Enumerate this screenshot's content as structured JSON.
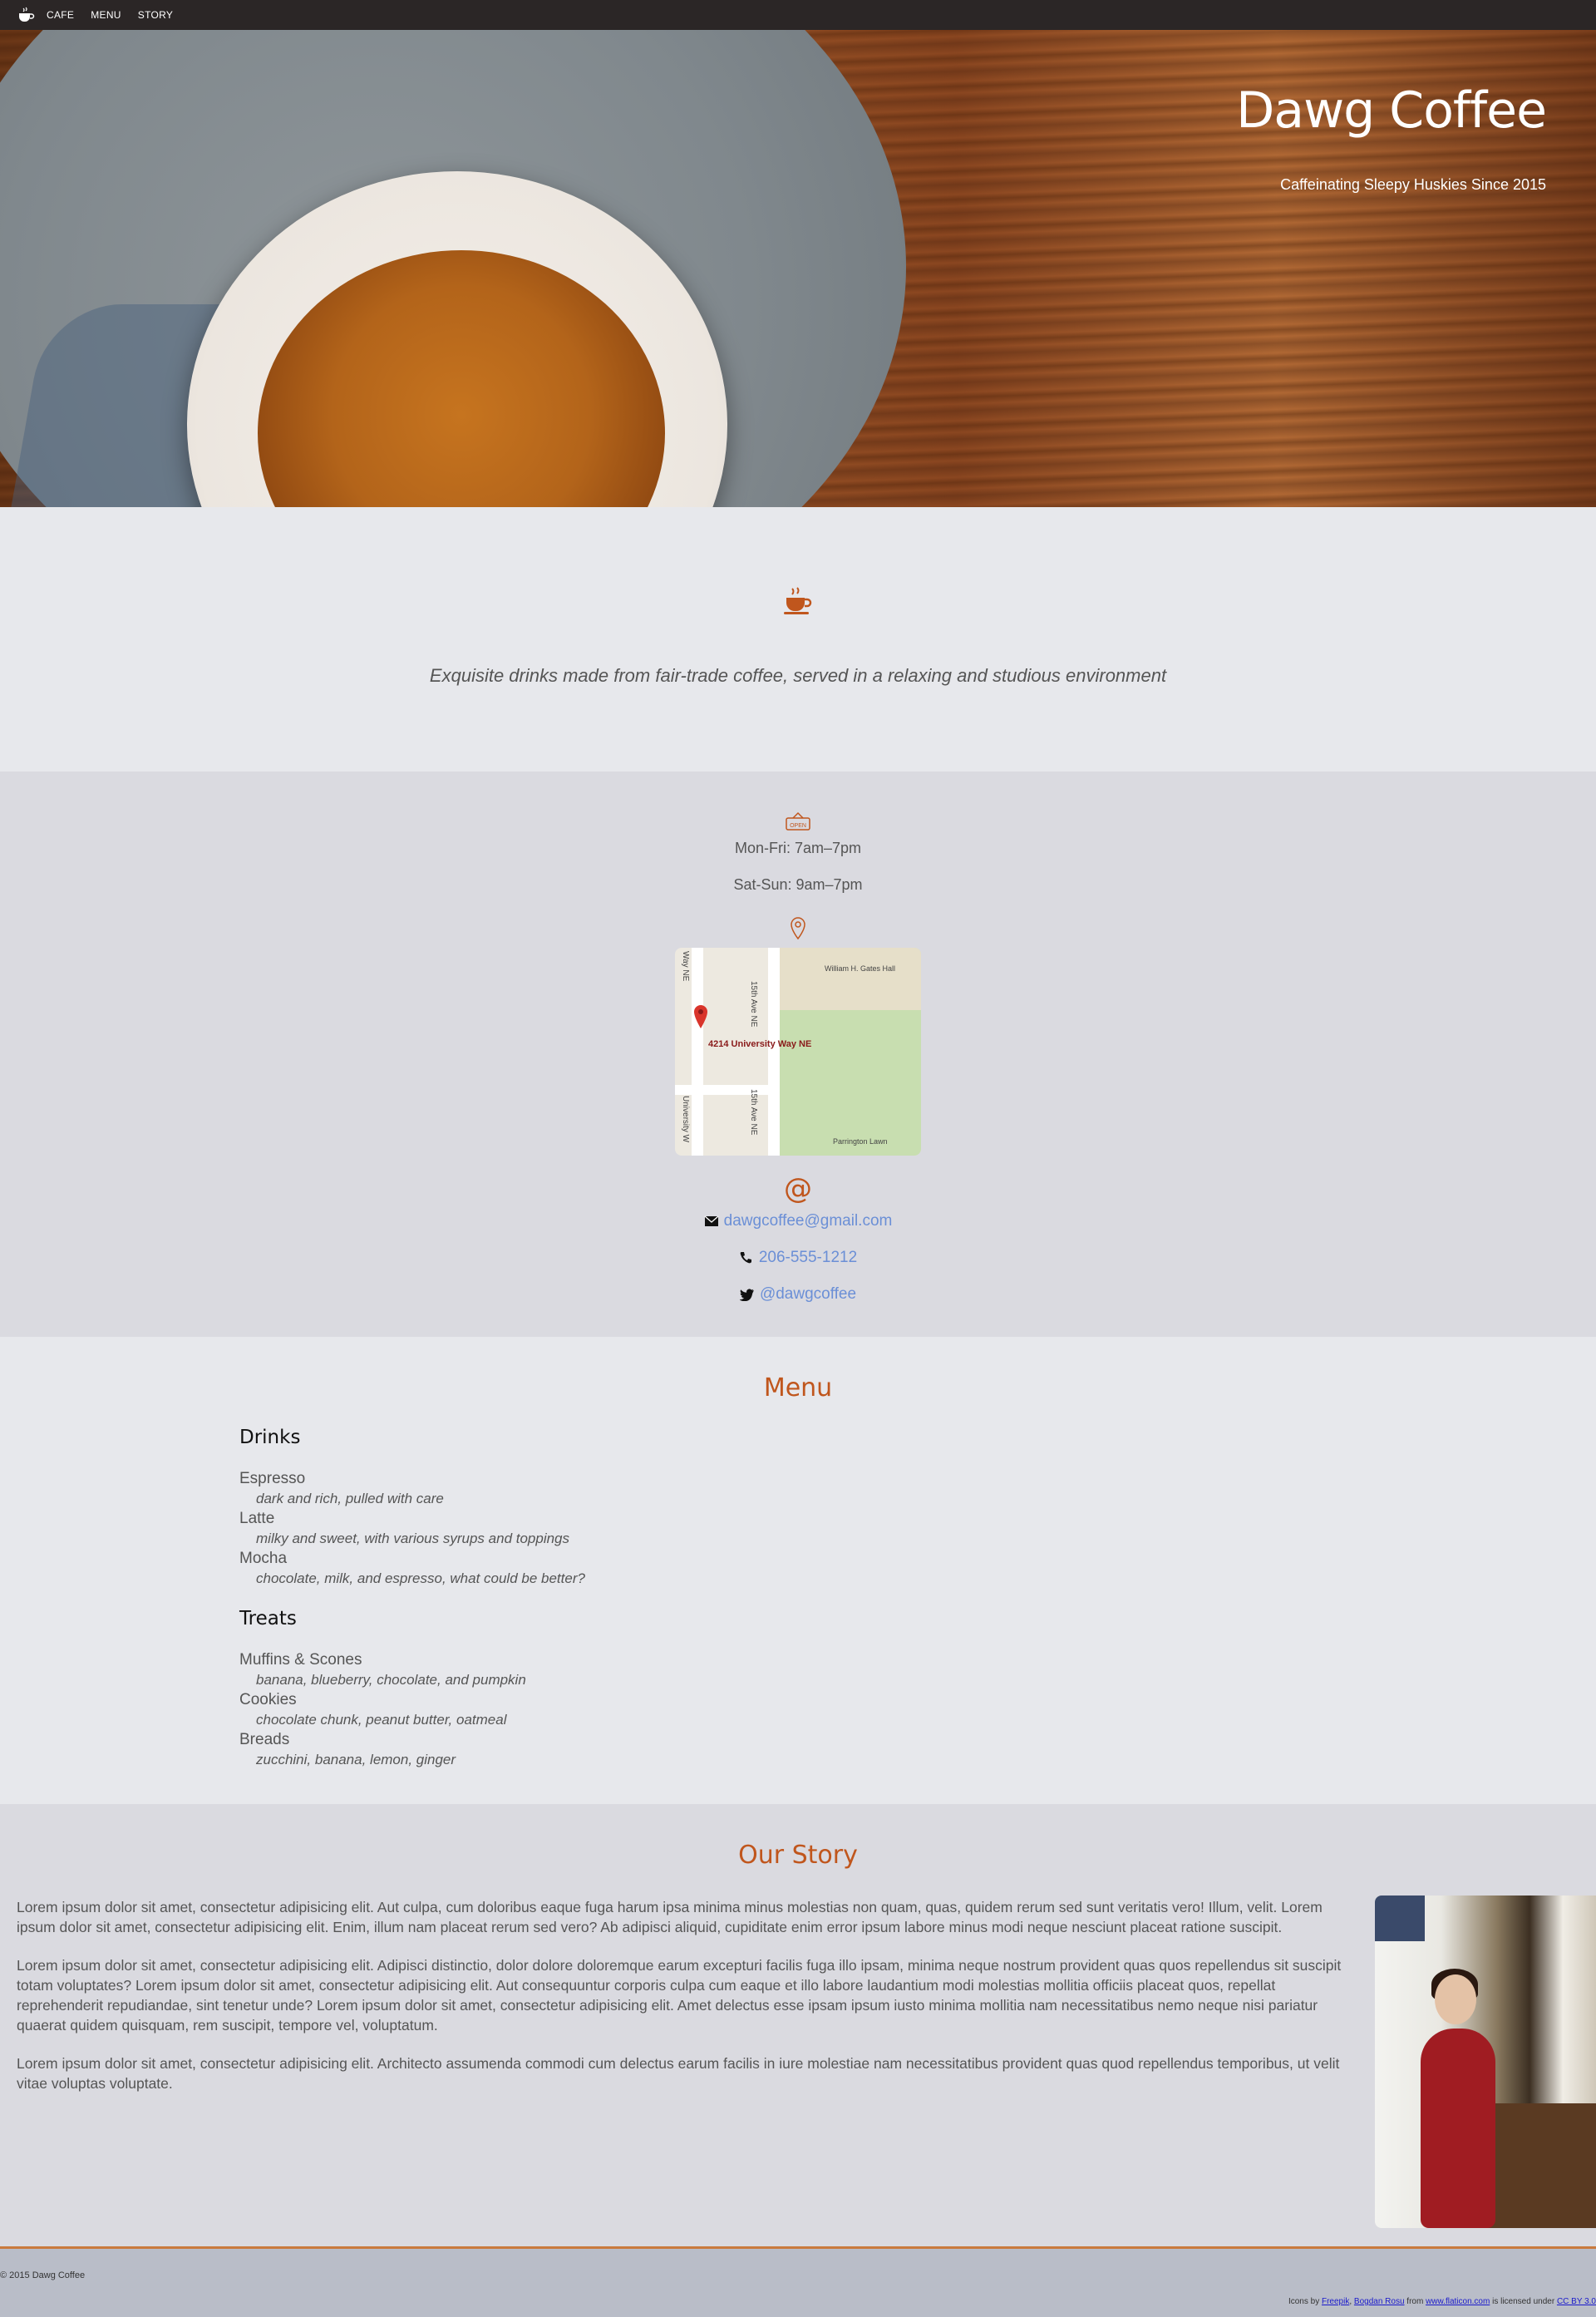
{
  "nav": {
    "items": [
      "CAFE",
      "MENU",
      "STORY"
    ]
  },
  "hero": {
    "title": "Dawg Coffee",
    "tagline": "Caffeinating Sleepy Huskies Since 2015"
  },
  "intro": {
    "text": "Exquisite drinks made from fair-trade coffee, served in a relaxing and studious environment"
  },
  "info": {
    "hours": [
      "Mon-Fri: 7am–7pm",
      "Sat-Sun: 9am–7pm"
    ],
    "map": {
      "address": "4214 University Way NE",
      "streets": [
        "15th Ave NE",
        "15th Ave NE",
        "Way NE",
        "University W"
      ],
      "places": [
        "William H. Gates Hall",
        "Parrington Lawn"
      ]
    },
    "at_symbol": "@",
    "email": "dawgcoffee@gmail.com",
    "phone": "206-555-1212",
    "twitter": "@dawgcoffee",
    "colors": {
      "accent": "#c0561d",
      "link": "#6b8fd6"
    }
  },
  "menu": {
    "title": "Menu",
    "sections": [
      {
        "name": "Drinks",
        "items": [
          {
            "name": "Espresso",
            "desc": "dark and rich, pulled with care"
          },
          {
            "name": "Latte",
            "desc": "milky and sweet, with various syrups and toppings"
          },
          {
            "name": "Mocha",
            "desc": "chocolate, milk, and espresso, what could be better?"
          }
        ]
      },
      {
        "name": "Treats",
        "items": [
          {
            "name": "Muffins & Scones",
            "desc": "banana, blueberry, chocolate, and pumpkin"
          },
          {
            "name": "Cookies",
            "desc": "chocolate chunk, peanut butter, oatmeal"
          },
          {
            "name": "Breads",
            "desc": "zucchini, banana, lemon, ginger"
          }
        ]
      }
    ]
  },
  "story": {
    "title": "Our Story",
    "paragraphs": [
      "Lorem ipsum dolor sit amet, consectetur adipisicing elit. Aut culpa, cum doloribus eaque fuga harum ipsa minima minus molestias non quam, quas, quidem rerum sed sunt veritatis vero! Illum, velit. Lorem ipsum dolor sit amet, consectetur adipisicing elit. Enim, illum nam placeat rerum sed vero? Ab adipisci aliquid, cupiditate enim error ipsum labore minus modi neque nesciunt placeat ratione suscipit.",
      "Lorem ipsum dolor sit amet, consectetur adipisicing elit. Adipisci distinctio, dolor dolore doloremque earum excepturi facilis fuga illo ipsam, minima neque nostrum provident quas quos repellendus sit suscipit totam voluptates? Lorem ipsum dolor sit amet, consectetur adipisicing elit. Aut consequuntur corporis culpa cum eaque et illo labore laudantium modi molestias mollitia officiis placeat quos, repellat reprehenderit repudiandae, sint tenetur unde? Lorem ipsum dolor sit amet, consectetur adipisicing elit. Amet delectus esse ipsam ipsum iusto minima mollitia nam necessitatibus nemo neque nisi pariatur quaerat quidem quisquam, rem suscipit, tempore vel, voluptatum.",
      "Lorem ipsum dolor sit amet, consectetur adipisicing elit. Architecto assumenda commodi cum delectus earum facilis in iure molestiae nam necessitatibus provident quas quod repellendus temporibus, ut velit vitae voluptas voluptate."
    ]
  },
  "footer": {
    "copyright": "© 2015 Dawg Coffee",
    "credit_prefix": "Icons by",
    "credit_author1": "Freepik",
    "credit_sep": ",",
    "credit_author2": "Bogdan Rosu",
    "credit_from": "from",
    "credit_site": "www.flaticon.com",
    "credit_licensed": "is licensed under",
    "credit_license": "CC BY 3.0"
  }
}
